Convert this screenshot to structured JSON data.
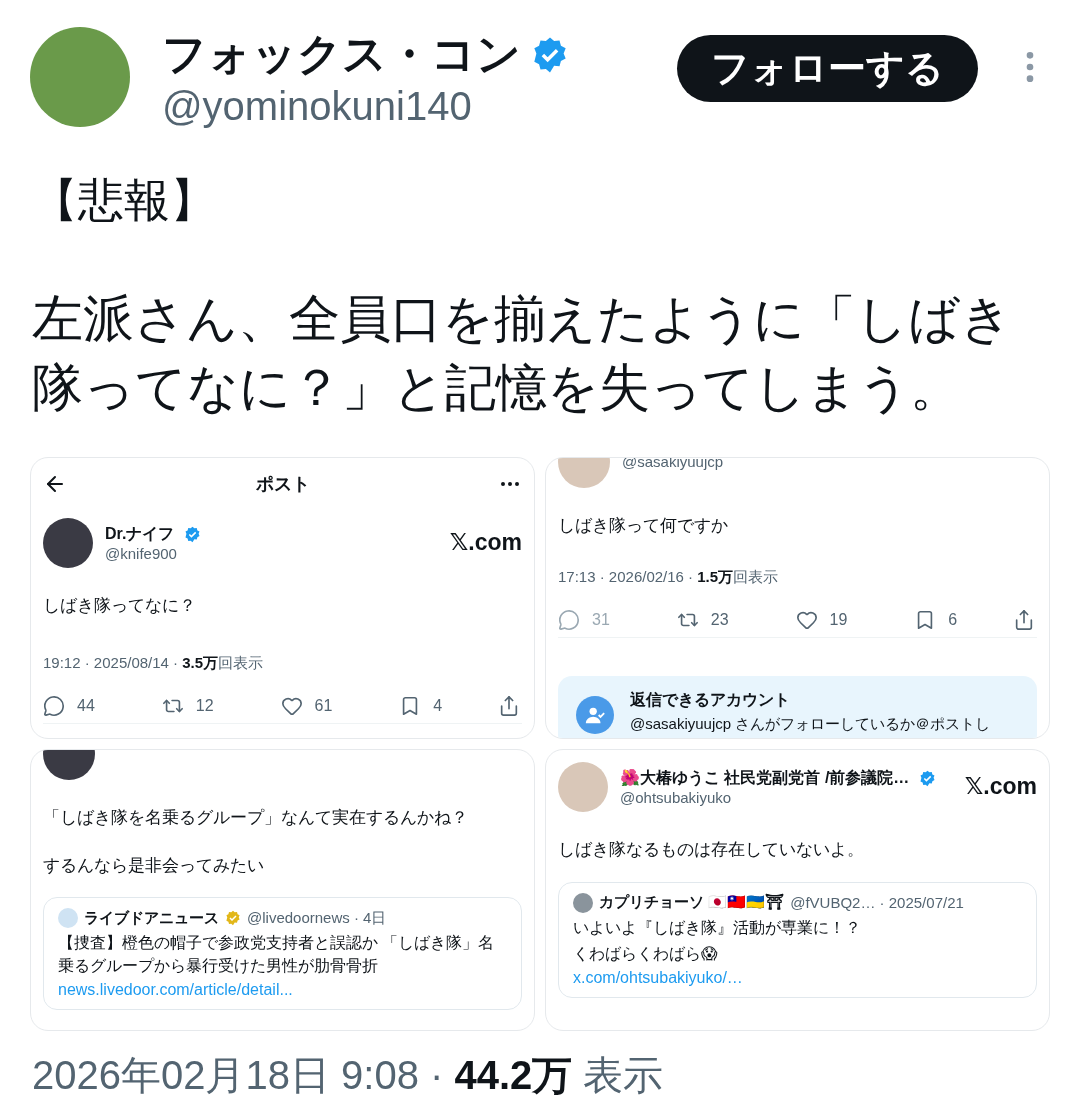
{
  "author": {
    "name": "フォックス・コン",
    "handle": "@yominokuni140",
    "verified": true
  },
  "follow_button": "フォローする",
  "post": {
    "lines": [
      "【悲報】",
      "左派さん、全員口を揃えたように「しばき隊ってなに？」と記憶を失ってしまう。"
    ]
  },
  "screenshots": [
    {
      "topbar": {
        "title": "ポスト"
      },
      "author": {
        "name": "Dr.ナイフ",
        "handle": "@knife900",
        "verified": true,
        "site": "𝕏.com"
      },
      "body": [
        "しばき隊ってなに？"
      ],
      "meta": "19:12 · 2025/08/14 · **3.5万**回表示",
      "actions": [
        {
          "kind": "reply",
          "count": "44",
          "disabled": false
        },
        {
          "kind": "repost",
          "count": "12",
          "disabled": false
        },
        {
          "kind": "like",
          "count": "61",
          "disabled": false
        },
        {
          "kind": "bookmark",
          "count": "4",
          "disabled": false
        },
        {
          "kind": "share",
          "disabled": false
        }
      ]
    },
    {
      "author": {
        "handle": "@sasakiyuujcp"
      },
      "body": [
        "しばき隊って何ですか"
      ],
      "meta": "17:13 · 2026/02/16 · **1.5万**回表示",
      "actions": [
        {
          "kind": "reply",
          "count": "31",
          "disabled": true
        },
        {
          "kind": "repost",
          "count": "23",
          "disabled": false
        },
        {
          "kind": "like",
          "count": "19",
          "disabled": false
        },
        {
          "kind": "bookmark",
          "count": "6",
          "disabled": false
        },
        {
          "kind": "share",
          "disabled": false
        }
      ],
      "notice": {
        "title": "返信できるアカウント",
        "text": "@sasakiyuujcp さんがフォローしているか＠ポストし"
      }
    },
    {
      "body": [
        "「しばき隊を名乗るグループ」なんて実在するんかね？",
        "するんなら是非会ってみたい"
      ],
      "quote": {
        "name": "ライブドアニュース",
        "verified": true,
        "handle": "@livedoornews · 4日",
        "lines": [
          "【捜査】橙色の帽子で参政党支持者と誤認か 「しばき隊」名乗るグループから暴行受けた男性が肋骨骨折"
        ],
        "link": "news.livedoor.com/article/detail..."
      }
    },
    {
      "author": {
        "name": "🌺大椿ゆうこ 社民党副党首 /前参議院…",
        "handle": "@ohtsubakiyuko",
        "verified": true,
        "site": "𝕏.com"
      },
      "body": [
        "しばき隊なるものは存在していないよ。"
      ],
      "quote": {
        "name": "カプリチョーソ 🇯🇵🇹🇼🇺🇦⛩",
        "verified": false,
        "handle": "@fVUBQ2… · 2025/07/21",
        "lines": [
          "いよいよ『しばき隊』活動が専業に！？",
          "くわばらくわばら😱"
        ],
        "link": "x.com/ohtsubakiyuko/…"
      }
    }
  ],
  "timestamp": "2026年02月18日 9:08 · **44.2万** 表示"
}
